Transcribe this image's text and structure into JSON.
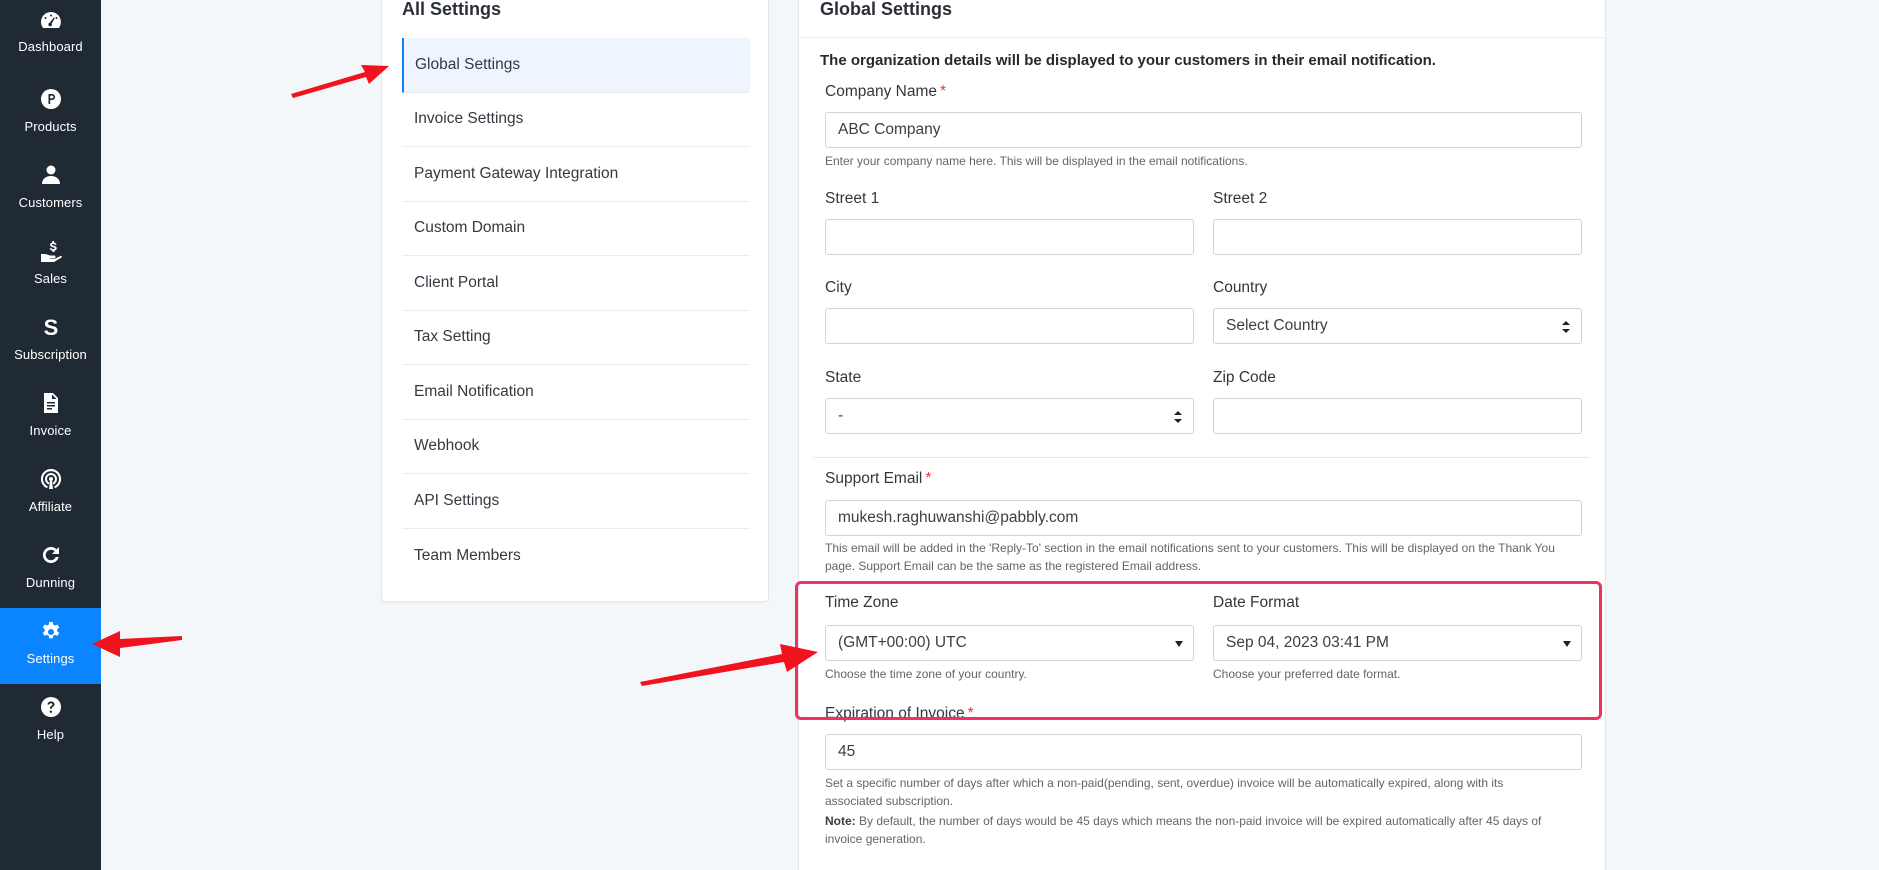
{
  "nav": {
    "items": [
      {
        "label": "Dashboard",
        "icon": "dashboard-icon",
        "active": false
      },
      {
        "label": "Products",
        "icon": "products-icon",
        "active": false
      },
      {
        "label": "Customers",
        "icon": "user-icon",
        "active": false
      },
      {
        "label": "Sales",
        "icon": "sales-icon",
        "active": false
      },
      {
        "label": "Subscription",
        "icon": "subscription-icon",
        "active": false
      },
      {
        "label": "Invoice",
        "icon": "invoice-icon",
        "active": false
      },
      {
        "label": "Affiliate",
        "icon": "affiliate-icon",
        "active": false
      },
      {
        "label": "Dunning",
        "icon": "refresh-icon",
        "active": false
      },
      {
        "label": "Settings",
        "icon": "gear-icon",
        "active": true
      },
      {
        "label": "Help",
        "icon": "help-icon",
        "active": false
      }
    ]
  },
  "menu": {
    "title": "All Settings",
    "items": [
      {
        "label": "Global Settings",
        "active": true
      },
      {
        "label": "Invoice Settings",
        "active": false
      },
      {
        "label": "Payment Gateway Integration",
        "active": false
      },
      {
        "label": "Custom Domain",
        "active": false
      },
      {
        "label": "Client Portal",
        "active": false
      },
      {
        "label": "Tax Setting",
        "active": false
      },
      {
        "label": "Email Notification",
        "active": false
      },
      {
        "label": "Webhook",
        "active": false
      },
      {
        "label": "API Settings",
        "active": false
      },
      {
        "label": "Team Members",
        "active": false
      }
    ]
  },
  "form": {
    "title": "Global Settings",
    "intro": "The organization details will be displayed to your customers in their email notification.",
    "company_name": {
      "label": "Company Name",
      "required": "*",
      "value": "ABC  Company",
      "help": "Enter your company name here. This will be displayed in the email notifications."
    },
    "street1": {
      "label": "Street 1",
      "value": ""
    },
    "street2": {
      "label": "Street 2",
      "value": ""
    },
    "city": {
      "label": "City",
      "value": ""
    },
    "country": {
      "label": "Country",
      "value": "Select Country"
    },
    "state": {
      "label": "State",
      "value": "-"
    },
    "zip": {
      "label": "Zip Code",
      "value": ""
    },
    "support_email": {
      "label": "Support Email",
      "required": "*",
      "value": "mukesh.raghuwanshi@pabbly.com",
      "help_line1": "This email will be added in the 'Reply-To' section in the email notifications sent to your customers. This will be displayed on the Thank You",
      "help_line2": "page. Support Email can be the same as the registered Email address."
    },
    "time_zone": {
      "label": "Time Zone",
      "value": "(GMT+00:00) UTC",
      "help": "Choose the time zone of your country."
    },
    "date_format": {
      "label": "Date Format",
      "value": "Sep 04, 2023 03:41 PM",
      "help": "Choose your preferred date format."
    },
    "expiration": {
      "label": "Expiration of Invoice",
      "required": "*",
      "value": "45",
      "help_line1": "Set a specific number of days after which a non-paid(pending, sent, overdue) invoice will be automatically expired, along with its",
      "help_line2": "associated subscription.",
      "note_label": "Note:",
      "note_line1": " By default, the number of days would be 45 days which means the non-paid invoice will be expired automatically after 45 days of",
      "note_line2": "invoice generation."
    }
  },
  "colors": {
    "nav_bg": "#202a35",
    "accent": "#0a84ff",
    "highlight": "#ee3363",
    "arrow": "#f0131d"
  }
}
